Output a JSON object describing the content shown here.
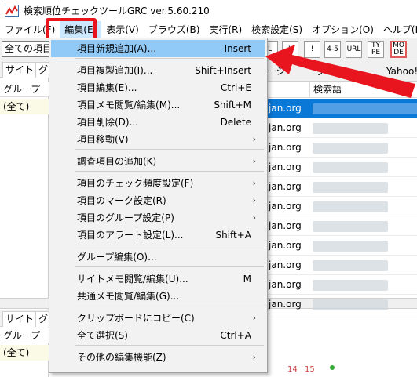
{
  "window": {
    "title": "検索順位チェックツールGRC  ver.5.60.210"
  },
  "menubar": {
    "items": [
      {
        "label": "ファイル(F)"
      },
      {
        "label": "編集(E)"
      },
      {
        "label": "表示(V)"
      },
      {
        "label": "ブラウズ(B)"
      },
      {
        "label": "実行(R)"
      },
      {
        "label": "検索設定(S)"
      },
      {
        "label": "オプション(O)"
      },
      {
        "label": "ヘルプ(H)"
      }
    ]
  },
  "toolbar": {
    "combo_value": "全ての項目",
    "buttons": [
      {
        "label": "L"
      },
      {
        "label": "L"
      },
      {
        "label": "!"
      },
      {
        "label": "4-5"
      },
      {
        "label": "URL"
      },
      {
        "label": "TY PE"
      },
      {
        "label": "MO DE"
      }
    ]
  },
  "left_panel": {
    "top": {
      "tabs": [
        "サイト",
        "グ"
      ],
      "group_header": "グループ",
      "group_row": "(全て)"
    },
    "bottom": {
      "tabs": [
        "サイト",
        "グ"
      ],
      "group_header": "グループ",
      "group_row": "(全て)"
    }
  },
  "right_panel": {
    "tabs": [
      "ージ",
      "グラフ",
      "Yahoo!"
    ],
    "column_header": "検索語",
    "rows": [
      {
        "url": "jan.org",
        "selected": true
      },
      {
        "url": "jan.org",
        "selected": false
      },
      {
        "url": "jan.org",
        "selected": false
      },
      {
        "url": "jan.org",
        "selected": false
      },
      {
        "url": "jan.org",
        "selected": false
      },
      {
        "url": "jan.org",
        "selected": false
      },
      {
        "url": "jan.org",
        "selected": false
      },
      {
        "url": "jan.org",
        "selected": false
      },
      {
        "url": "jan.org",
        "selected": false
      },
      {
        "url": "jan.org",
        "selected": false
      },
      {
        "url": "jan.org",
        "selected": false
      }
    ],
    "axis_labels": [
      "14",
      "15"
    ]
  },
  "edit_menu": {
    "items": [
      {
        "label": "項目新規追加(A)...",
        "shortcut": "Insert",
        "highlighted": true
      },
      {
        "label": "項目複製追加(I)...",
        "shortcut": "Shift+Insert"
      },
      {
        "label": "項目編集(E)...",
        "shortcut": "Ctrl+E"
      },
      {
        "label": "項目メモ閲覧/編集(M)...",
        "shortcut": "Shift+M"
      },
      {
        "label": "項目削除(D)...",
        "shortcut": "Delete"
      },
      {
        "label": "項目移動(V)",
        "submenu": true
      },
      {
        "label": "調査項目の追加(K)",
        "submenu": true
      },
      {
        "label": "項目のチェック頻度設定(F)",
        "submenu": true
      },
      {
        "label": "項目のマーク設定(R)",
        "submenu": true
      },
      {
        "label": "項目のグループ設定(P)",
        "submenu": true
      },
      {
        "label": "項目のアラート設定(L)...",
        "shortcut": "Shift+A"
      },
      {
        "label": "グループ編集(O)..."
      },
      {
        "label": "サイトメモ閲覧/編集(U)...",
        "shortcut": "M"
      },
      {
        "label": "共通メモ閲覧/編集(G)..."
      },
      {
        "label": "クリップボードにコピー(C)",
        "submenu": true
      },
      {
        "label": "全て選択(S)",
        "shortcut": "Ctrl+A"
      },
      {
        "label": "その他の編集機能(Z)",
        "submenu": true
      }
    ]
  },
  "colors": {
    "highlight_red": "#e8141e",
    "menu_highlight": "#91c9f7",
    "selection_blue": "#0a78d7"
  }
}
